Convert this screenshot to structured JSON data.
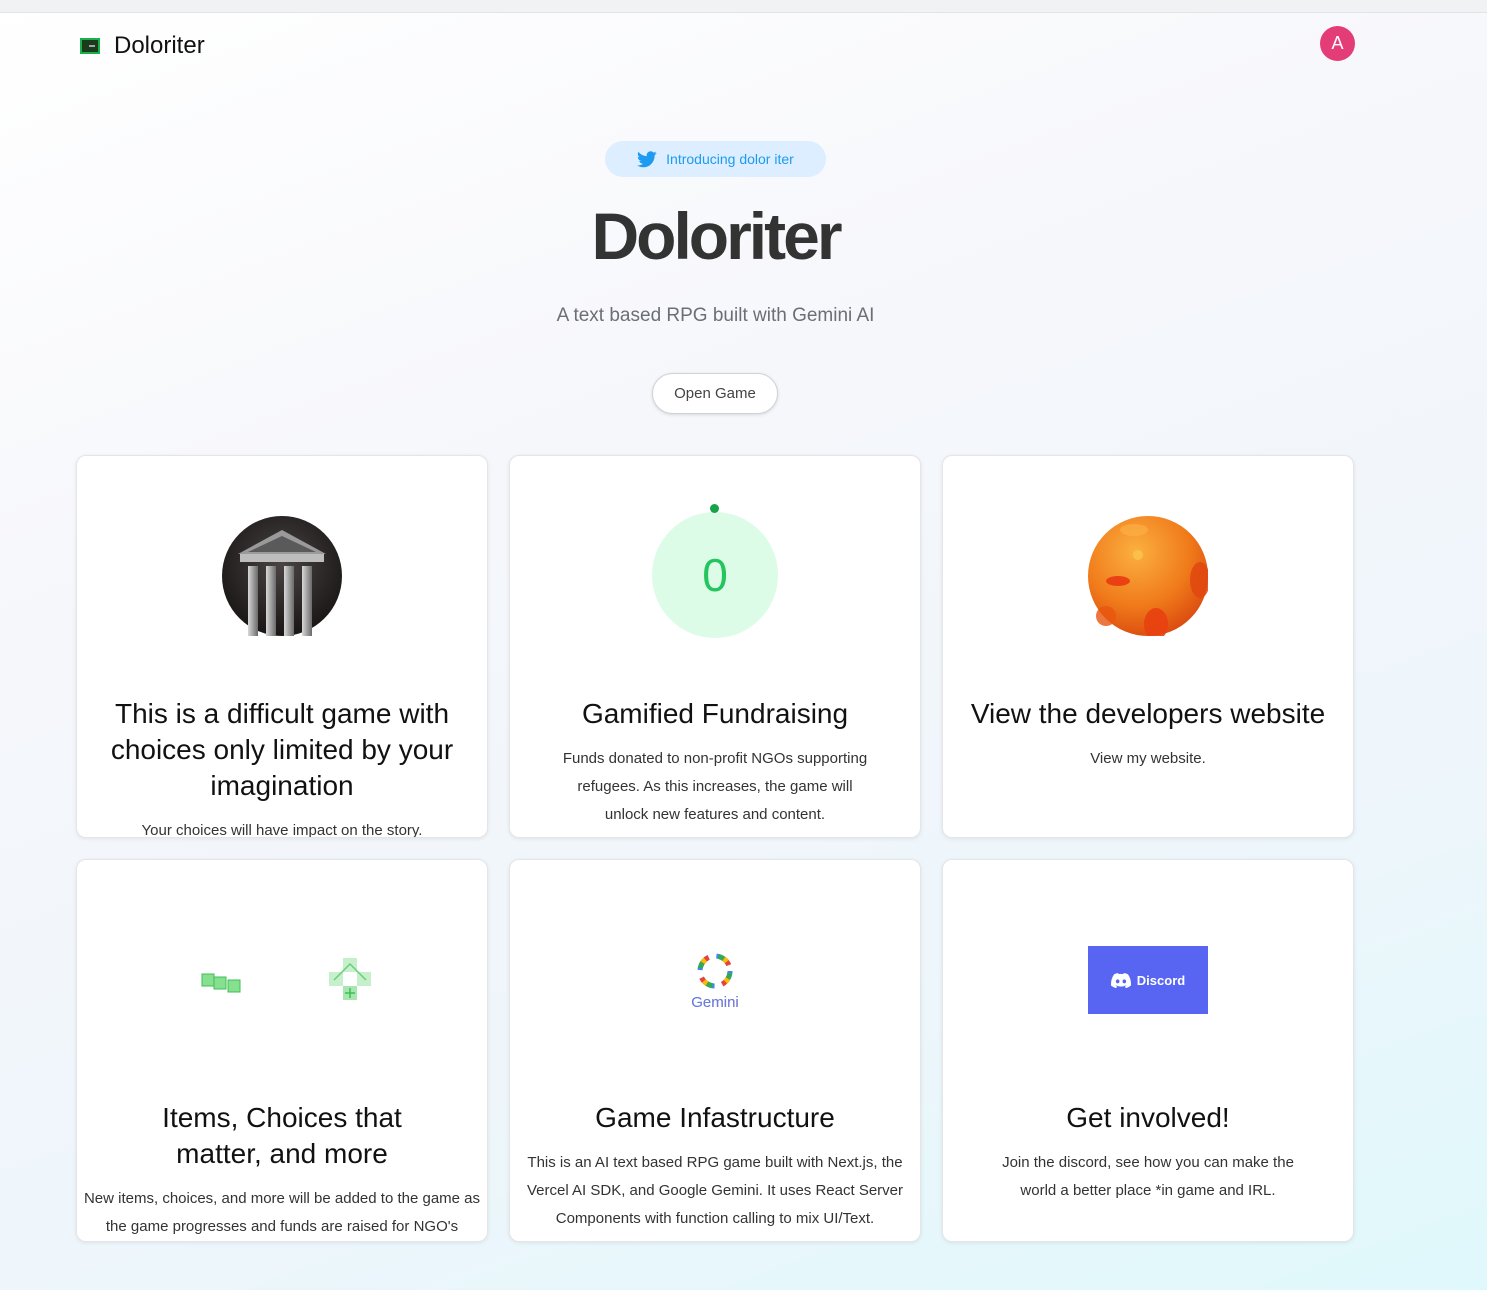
{
  "app": {
    "logo_text": "Doloriter",
    "avatar_initial": "A"
  },
  "hero": {
    "badge": "Introducing dolor iter",
    "title": "Doloriter",
    "subtitle": "A text based RPG built with Gemini AI",
    "cta": "Open Game"
  },
  "cards": [
    {
      "title": "This is a difficult game with choices only limited by your imagination",
      "description": "Your choices will have impact on the story."
    },
    {
      "counter": "0",
      "title": "Gamified Fundraising",
      "description": "Funds donated to non-profit NGOs supporting refugees. As this increases, the game will unlock new features and content."
    },
    {
      "title": "View the developers website",
      "description": "View my website."
    },
    {
      "title": "Items, Choices that matter, and more",
      "description": "New items, choices, and more will be added to the game as the game progresses and funds are raised for NGO's"
    },
    {
      "logo_text": "Gemini",
      "title": "Game Infastructure",
      "description": "This is an AI text based RPG game built with Next.js, the Vercel AI SDK, and Google Gemini. It uses React Server Components with function calling to mix UI/Text."
    },
    {
      "button_label": "Discord",
      "title": "Get involved!",
      "description": "Join the discord, see how you can make the world a better place *in game and IRL."
    }
  ],
  "colors": {
    "accent_twitter": "#1d9bf0",
    "avatar": "#e33c76",
    "counter_green": "#22c55e",
    "discord": "#5865f2"
  },
  "icons": [
    "twitter-icon",
    "temple-icon",
    "planet-icon",
    "green-tiles-icon",
    "gemini-logo-icon",
    "discord-icon"
  ]
}
